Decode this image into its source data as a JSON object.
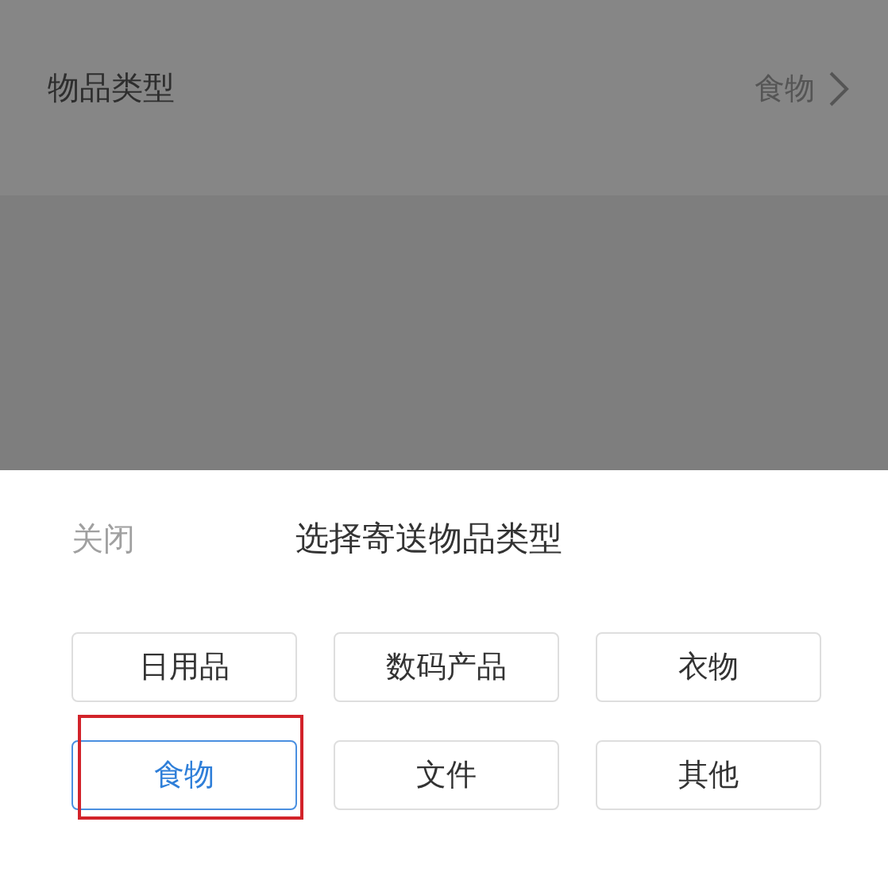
{
  "field_row": {
    "label": "物品类型",
    "value": "食物"
  },
  "sheet": {
    "close": "关闭",
    "title": "选择寄送物品类型",
    "options": [
      {
        "label": "日用品",
        "selected": false,
        "highlighted": false
      },
      {
        "label": "数码产品",
        "selected": false,
        "highlighted": false
      },
      {
        "label": "衣物",
        "selected": false,
        "highlighted": false
      },
      {
        "label": "食物",
        "selected": true,
        "highlighted": true
      },
      {
        "label": "文件",
        "selected": false,
        "highlighted": false
      },
      {
        "label": "其他",
        "selected": false,
        "highlighted": false
      }
    ]
  }
}
